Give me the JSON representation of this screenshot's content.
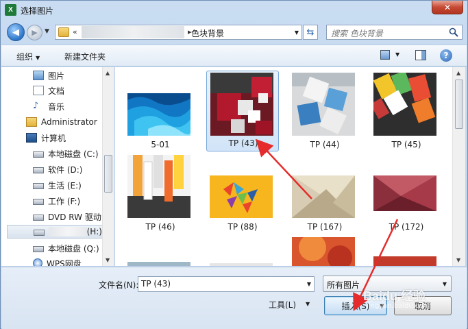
{
  "window": {
    "title": "选择图片",
    "app_icon": "excel-icon",
    "close_glyph": "✕"
  },
  "address": {
    "current_folder": "色块背景",
    "search_placeholder": "搜索 色块背景",
    "back_glyph": "◀",
    "forward_glyph": "▶"
  },
  "toolbar": {
    "organize_label": "组织",
    "new_folder_label": "新建文件夹",
    "help_glyph": "?"
  },
  "sidebar": {
    "items": [
      {
        "label": "图片",
        "icon": "pictures-icon"
      },
      {
        "label": "文档",
        "icon": "documents-icon"
      },
      {
        "label": "音乐",
        "icon": "music-icon"
      },
      {
        "label": "Administrator",
        "icon": "user-folder-icon"
      },
      {
        "label": "计算机",
        "icon": "computer-icon"
      },
      {
        "label": "本地磁盘 (C:)",
        "icon": "drive-icon"
      },
      {
        "label": "软件 (D:)",
        "icon": "drive-icon"
      },
      {
        "label": "生活 (E:)",
        "icon": "drive-icon"
      },
      {
        "label": "工作 (F:)",
        "icon": "drive-icon"
      },
      {
        "label": "DVD RW 驱动",
        "icon": "dvd-drive-icon"
      },
      {
        "label": "(H:)",
        "icon": "removable-drive-icon"
      },
      {
        "label": "本地磁盘 (Q:)",
        "icon": "drive-icon"
      },
      {
        "label": "WPS网盘",
        "icon": "wps-cloud-icon"
      }
    ]
  },
  "files": [
    {
      "name": "5-01",
      "selected": false
    },
    {
      "name": "TP (43)",
      "selected": true
    },
    {
      "name": "TP (44)",
      "selected": false
    },
    {
      "name": "TP (45)",
      "selected": false
    },
    {
      "name": "TP (46)",
      "selected": false
    },
    {
      "name": "TP (88)",
      "selected": false
    },
    {
      "name": "TP (167)",
      "selected": false
    },
    {
      "name": "TP (172)",
      "selected": false
    }
  ],
  "bottom": {
    "filename_label": "文件名(N):",
    "filename_value": "TP (43)",
    "filetype_value": "所有图片",
    "tools_label": "工具(L)",
    "insert_label": "插入(S)",
    "cancel_label": "取消"
  },
  "watermark": {
    "text": "Baidu 经验",
    "sub": "jingyan.baidu.com"
  },
  "colors": {
    "annotation_arrow": "#e52b2b",
    "selection_border": "#7aa9dc"
  }
}
